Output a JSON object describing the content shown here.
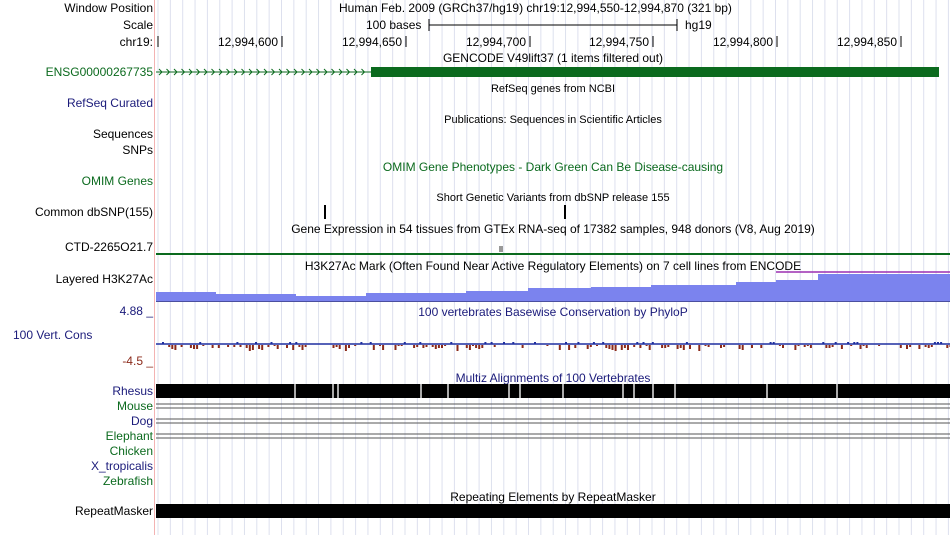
{
  "header": {
    "window_position_label": "Window Position",
    "window_position_value": "Human Feb. 2009 (GRCh37/hg19)   chr19:12,994,550-12,994,870 (321 bp)",
    "scale_label": "Scale",
    "scale_value": "100 bases",
    "scale_assembly": "hg19",
    "chrom_label": "chr19:",
    "ruler_ticks": [
      "12,994,600",
      "12,994,650",
      "12,994,700",
      "12,994,750",
      "12,994,800",
      "12,994,850"
    ]
  },
  "tracks": {
    "gencode": {
      "title": "GENCODE V49lift37 (1 items filtered out)",
      "item_label": "ENSG00000267735",
      "color": "#0b6a1e"
    },
    "refseq": {
      "title": "RefSeq genes from NCBI",
      "label": "RefSeq Curated"
    },
    "publications": {
      "title": "Publications: Sequences in Scientific Articles",
      "label": "Sequences"
    },
    "snps": {
      "label": "SNPs"
    },
    "omim": {
      "title": "OMIM Gene Phenotypes - Dark Green Can Be Disease-causing",
      "label": "OMIM Genes",
      "color": "#0b6a1e"
    },
    "dbsnp": {
      "title": "Short Genetic Variants from dbSNP release 155",
      "label": "Common dbSNP(155)"
    },
    "gtex": {
      "title": "Gene Expression in 54 tissues from GTEx RNA-seq of 17382 samples, 948 donors (V8, Aug 2019)",
      "label": "CTD-2265O21.7"
    },
    "h3k27ac": {
      "title": "H3K27Ac Mark (Often Found Near Active Regulatory Elements) on 7 cell lines from ENCODE",
      "label": "Layered H3K27Ac",
      "color": "#7b83ee"
    },
    "phylop": {
      "title": "100 vertebrates Basewise Conservation by PhyloP",
      "label": "100 Vert. Cons",
      "max_label": "4.88 _",
      "min_label": "-4.5 _",
      "pos_color": "#1f2fa0",
      "neg_color": "#8b2a1a"
    },
    "multiz": {
      "title": "Multiz Alignments of 100 Vertebrates",
      "species": [
        "Rhesus",
        "Mouse",
        "Dog",
        "Elephant",
        "Chicken",
        "X_tropicalis",
        "Zebrafish"
      ]
    },
    "repeatmasker": {
      "title": "Repeating Elements by RepeatMasker",
      "label": "RepeatMasker"
    }
  },
  "colors": {
    "label_blue": "#1a1a7a",
    "label_green": "#0b6a1e",
    "divider": "#f3b3b3",
    "grid": "#dde0ee"
  }
}
